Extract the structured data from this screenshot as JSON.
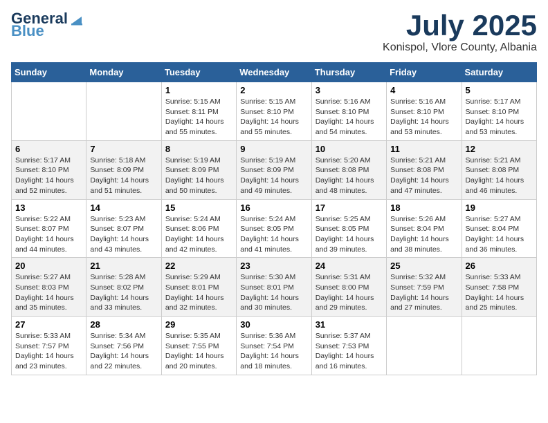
{
  "logo": {
    "text_general": "General",
    "text_blue": "Blue"
  },
  "header": {
    "month": "July 2025",
    "location": "Konispol, Vlore County, Albania"
  },
  "days_of_week": [
    "Sunday",
    "Monday",
    "Tuesday",
    "Wednesday",
    "Thursday",
    "Friday",
    "Saturday"
  ],
  "weeks": [
    [
      {
        "day": "",
        "info": ""
      },
      {
        "day": "",
        "info": ""
      },
      {
        "day": "1",
        "info": "Sunrise: 5:15 AM\nSunset: 8:11 PM\nDaylight: 14 hours and 55 minutes."
      },
      {
        "day": "2",
        "info": "Sunrise: 5:15 AM\nSunset: 8:10 PM\nDaylight: 14 hours and 55 minutes."
      },
      {
        "day": "3",
        "info": "Sunrise: 5:16 AM\nSunset: 8:10 PM\nDaylight: 14 hours and 54 minutes."
      },
      {
        "day": "4",
        "info": "Sunrise: 5:16 AM\nSunset: 8:10 PM\nDaylight: 14 hours and 53 minutes."
      },
      {
        "day": "5",
        "info": "Sunrise: 5:17 AM\nSunset: 8:10 PM\nDaylight: 14 hours and 53 minutes."
      }
    ],
    [
      {
        "day": "6",
        "info": "Sunrise: 5:17 AM\nSunset: 8:10 PM\nDaylight: 14 hours and 52 minutes."
      },
      {
        "day": "7",
        "info": "Sunrise: 5:18 AM\nSunset: 8:09 PM\nDaylight: 14 hours and 51 minutes."
      },
      {
        "day": "8",
        "info": "Sunrise: 5:19 AM\nSunset: 8:09 PM\nDaylight: 14 hours and 50 minutes."
      },
      {
        "day": "9",
        "info": "Sunrise: 5:19 AM\nSunset: 8:09 PM\nDaylight: 14 hours and 49 minutes."
      },
      {
        "day": "10",
        "info": "Sunrise: 5:20 AM\nSunset: 8:08 PM\nDaylight: 14 hours and 48 minutes."
      },
      {
        "day": "11",
        "info": "Sunrise: 5:21 AM\nSunset: 8:08 PM\nDaylight: 14 hours and 47 minutes."
      },
      {
        "day": "12",
        "info": "Sunrise: 5:21 AM\nSunset: 8:08 PM\nDaylight: 14 hours and 46 minutes."
      }
    ],
    [
      {
        "day": "13",
        "info": "Sunrise: 5:22 AM\nSunset: 8:07 PM\nDaylight: 14 hours and 44 minutes."
      },
      {
        "day": "14",
        "info": "Sunrise: 5:23 AM\nSunset: 8:07 PM\nDaylight: 14 hours and 43 minutes."
      },
      {
        "day": "15",
        "info": "Sunrise: 5:24 AM\nSunset: 8:06 PM\nDaylight: 14 hours and 42 minutes."
      },
      {
        "day": "16",
        "info": "Sunrise: 5:24 AM\nSunset: 8:05 PM\nDaylight: 14 hours and 41 minutes."
      },
      {
        "day": "17",
        "info": "Sunrise: 5:25 AM\nSunset: 8:05 PM\nDaylight: 14 hours and 39 minutes."
      },
      {
        "day": "18",
        "info": "Sunrise: 5:26 AM\nSunset: 8:04 PM\nDaylight: 14 hours and 38 minutes."
      },
      {
        "day": "19",
        "info": "Sunrise: 5:27 AM\nSunset: 8:04 PM\nDaylight: 14 hours and 36 minutes."
      }
    ],
    [
      {
        "day": "20",
        "info": "Sunrise: 5:27 AM\nSunset: 8:03 PM\nDaylight: 14 hours and 35 minutes."
      },
      {
        "day": "21",
        "info": "Sunrise: 5:28 AM\nSunset: 8:02 PM\nDaylight: 14 hours and 33 minutes."
      },
      {
        "day": "22",
        "info": "Sunrise: 5:29 AM\nSunset: 8:01 PM\nDaylight: 14 hours and 32 minutes."
      },
      {
        "day": "23",
        "info": "Sunrise: 5:30 AM\nSunset: 8:01 PM\nDaylight: 14 hours and 30 minutes."
      },
      {
        "day": "24",
        "info": "Sunrise: 5:31 AM\nSunset: 8:00 PM\nDaylight: 14 hours and 29 minutes."
      },
      {
        "day": "25",
        "info": "Sunrise: 5:32 AM\nSunset: 7:59 PM\nDaylight: 14 hours and 27 minutes."
      },
      {
        "day": "26",
        "info": "Sunrise: 5:33 AM\nSunset: 7:58 PM\nDaylight: 14 hours and 25 minutes."
      }
    ],
    [
      {
        "day": "27",
        "info": "Sunrise: 5:33 AM\nSunset: 7:57 PM\nDaylight: 14 hours and 23 minutes."
      },
      {
        "day": "28",
        "info": "Sunrise: 5:34 AM\nSunset: 7:56 PM\nDaylight: 14 hours and 22 minutes."
      },
      {
        "day": "29",
        "info": "Sunrise: 5:35 AM\nSunset: 7:55 PM\nDaylight: 14 hours and 20 minutes."
      },
      {
        "day": "30",
        "info": "Sunrise: 5:36 AM\nSunset: 7:54 PM\nDaylight: 14 hours and 18 minutes."
      },
      {
        "day": "31",
        "info": "Sunrise: 5:37 AM\nSunset: 7:53 PM\nDaylight: 14 hours and 16 minutes."
      },
      {
        "day": "",
        "info": ""
      },
      {
        "day": "",
        "info": ""
      }
    ]
  ]
}
